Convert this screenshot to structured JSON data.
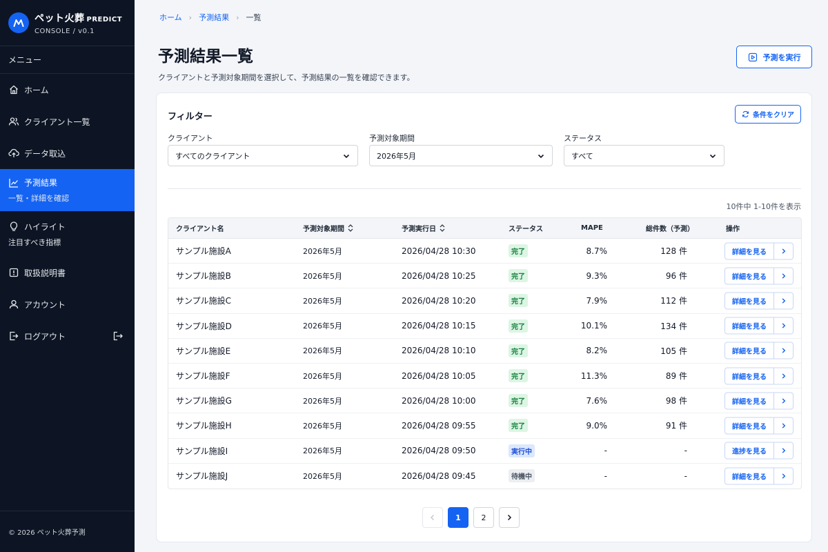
{
  "brand": {
    "name": "ペット火葬",
    "tag": "PREDICT",
    "sub": "CONSOLE  /  v0.1"
  },
  "sidebar": {
    "menu_heading": "メニュー",
    "items": [
      {
        "label": "ホーム",
        "icon": "home-icon"
      },
      {
        "label": "クライアント一覧",
        "icon": "users-icon"
      },
      {
        "label": "データ取込",
        "icon": "upload-icon"
      },
      {
        "label": "予測結果",
        "sub": "一覧・詳細を確認",
        "icon": "chart-line-icon",
        "active": true
      },
      {
        "label": "ハイライト",
        "sub": "注目すべき指標",
        "icon": "lightbulb-icon"
      },
      {
        "label": "取扱説明書",
        "icon": "manual-icon"
      },
      {
        "label": "アカウント",
        "icon": "user-icon"
      },
      {
        "label": "ログアウト",
        "icon": "logout-icon"
      }
    ],
    "footer": "© 2026 ペット火葬予測"
  },
  "breadcrumb": {
    "home": "ホーム",
    "results": "予測結果",
    "current": "一覧"
  },
  "page": {
    "title": "予測結果一覧",
    "description": "クライアントと予測対象期間を選択して、予測結果の一覧を確認できます。",
    "run_button": "予測を実行"
  },
  "filter": {
    "title": "フィルター",
    "clear_button": "条件をクリア",
    "client": {
      "label": "クライアント",
      "value": "すべてのクライアント"
    },
    "period": {
      "label": "予測対象期間",
      "value": "2026年5月"
    },
    "status": {
      "label": "ステータス",
      "value": "すべて"
    }
  },
  "result_count": "10件中 1-10件を表示",
  "table": {
    "headers": {
      "client": "クライアント名",
      "period": "予測対象期間",
      "run_date": "予測実行日",
      "status": "ステータス",
      "mape": "MAPE",
      "total": "総件数（予測）",
      "action": "操作"
    },
    "rows": [
      {
        "client": "サンプル施設A",
        "period": "2026年5月",
        "run_date": "2026/04/28 10:30",
        "status": "完了",
        "status_type": "done",
        "mape": "8.7%",
        "total": "128 件",
        "action": "詳細を見る"
      },
      {
        "client": "サンプル施設B",
        "period": "2026年5月",
        "run_date": "2026/04/28 10:25",
        "status": "完了",
        "status_type": "done",
        "mape": "9.3%",
        "total": "96 件",
        "action": "詳細を見る"
      },
      {
        "client": "サンプル施設C",
        "period": "2026年5月",
        "run_date": "2026/04/28 10:20",
        "status": "完了",
        "status_type": "done",
        "mape": "7.9%",
        "total": "112 件",
        "action": "詳細を見る"
      },
      {
        "client": "サンプル施設D",
        "period": "2026年5月",
        "run_date": "2026/04/28 10:15",
        "status": "完了",
        "status_type": "done",
        "mape": "10.1%",
        "total": "134 件",
        "action": "詳細を見る"
      },
      {
        "client": "サンプル施設E",
        "period": "2026年5月",
        "run_date": "2026/04/28 10:10",
        "status": "完了",
        "status_type": "done",
        "mape": "8.2%",
        "total": "105 件",
        "action": "詳細を見る"
      },
      {
        "client": "サンプル施設F",
        "period": "2026年5月",
        "run_date": "2026/04/28 10:05",
        "status": "完了",
        "status_type": "done",
        "mape": "11.3%",
        "total": "89 件",
        "action": "詳細を見る"
      },
      {
        "client": "サンプル施設G",
        "period": "2026年5月",
        "run_date": "2026/04/28 10:00",
        "status": "完了",
        "status_type": "done",
        "mape": "7.6%",
        "total": "98 件",
        "action": "詳細を見る"
      },
      {
        "client": "サンプル施設H",
        "period": "2026年5月",
        "run_date": "2026/04/28 09:55",
        "status": "完了",
        "status_type": "done",
        "mape": "9.0%",
        "total": "91 件",
        "action": "詳細を見る"
      },
      {
        "client": "サンプル施設I",
        "period": "2026年5月",
        "run_date": "2026/04/28 09:50",
        "status": "実行中",
        "status_type": "run",
        "mape": "-",
        "total": "-",
        "action": "進捗を見る"
      },
      {
        "client": "サンプル施設J",
        "period": "2026年5月",
        "run_date": "2026/04/28 09:45",
        "status": "待機中",
        "status_type": "wait",
        "mape": "-",
        "total": "-",
        "action": "詳細を見る"
      }
    ]
  },
  "pagination": {
    "pages": [
      "1",
      "2"
    ],
    "current": "1"
  },
  "colors": {
    "accent": "#1463f3",
    "sidebar_bg": "#0d1524",
    "done": "#15803d",
    "running": "#1d4ed8",
    "waiting": "#4b5563"
  }
}
